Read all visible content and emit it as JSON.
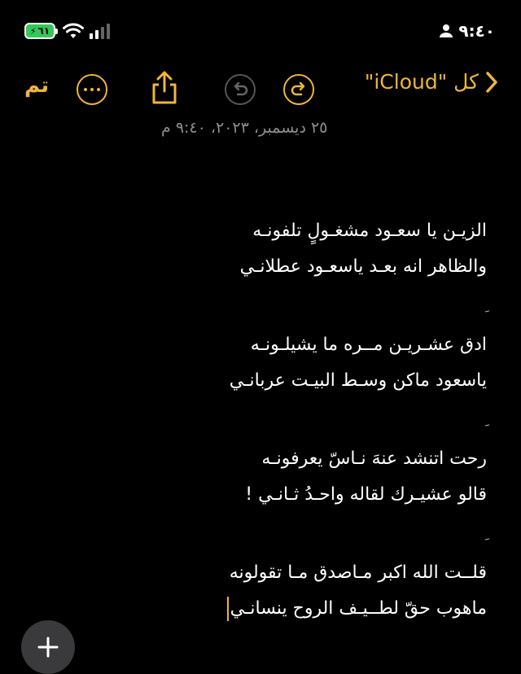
{
  "status_bar": {
    "time": "٩:٤٠",
    "battery_level": "٦١",
    "colors": {
      "battery": "#34c759"
    }
  },
  "toolbar": {
    "done_label": "تم",
    "back_label": "كل \"iCloud\"",
    "accent_color": "#f0b53a",
    "icons": [
      "more-icon",
      "share-icon",
      "undo-icon",
      "redo-icon",
      "chevron-left-icon"
    ]
  },
  "note": {
    "date": "٢٥ ديسمبر، ٢٠٢٣، ٩:٤٠ م",
    "stanzas": [
      [
        "الزيـن يا سعـود مشغـولٍ تلفونـه",
        "والظاهر انه بعـد ياسعـود عطلانـي"
      ],
      [
        "ادق عشـريـن مــره ما يشيلـونـه",
        "ياسعود ماكن وسـط البيـت عربانـي"
      ],
      [
        "رحت اتنشد عنهَ نـاسّ يعرفونـه",
        "قالو عشيـرك لقاله واحـدُ ثـانـي !"
      ],
      [
        "قلــت الله اكبر مـاصدق مـا تقولونه",
        "ماهوب حقّ لطــيـف الروح ينسانـي"
      ]
    ]
  },
  "fab": {
    "icon": "plus-icon"
  }
}
